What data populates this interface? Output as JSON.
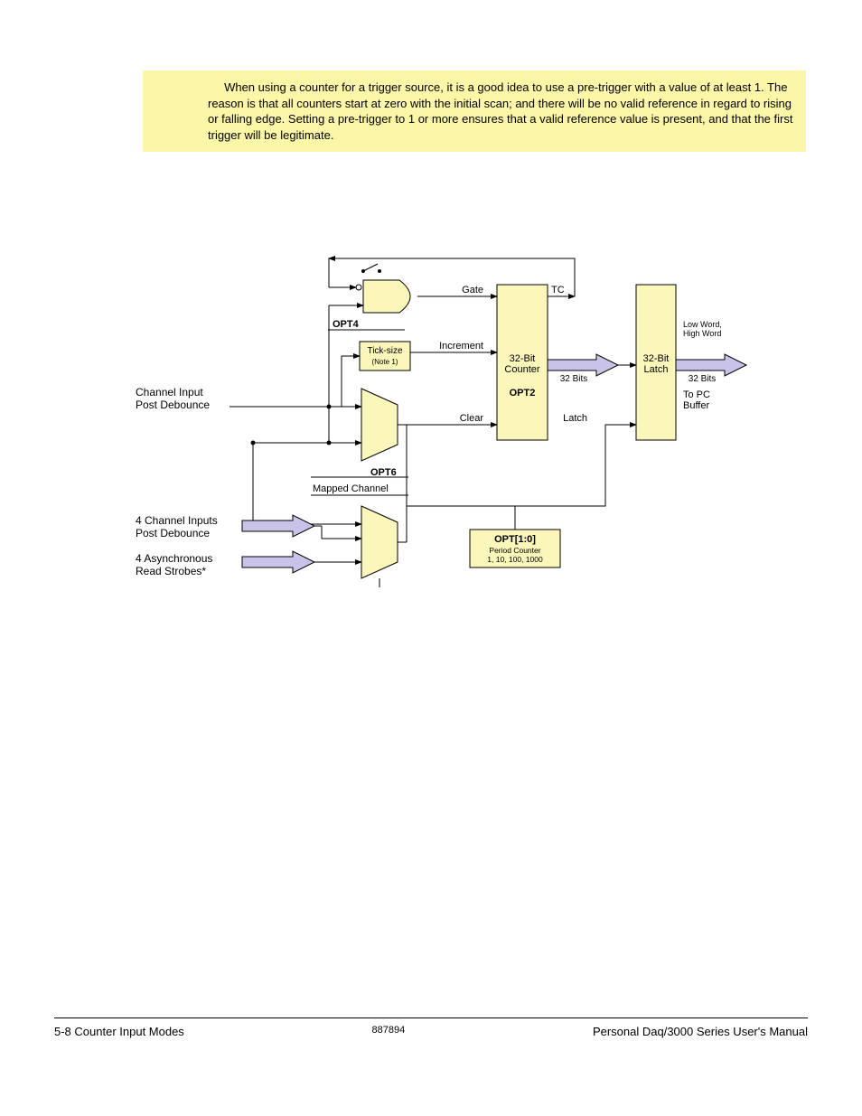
{
  "tip": {
    "text": "When using a counter for a trigger source, it is a good idea to use a pre-trigger with a value of at least 1. The reason is that all counters start at zero with the initial scan; and there will be no valid reference in regard to rising or falling edge. Setting a pre-trigger to 1 or more ensures that a valid reference value is present, and that the first trigger will be legitimate."
  },
  "diagram": {
    "opt4": "OPT4",
    "opt6": "OPT6",
    "opt2": "OPT2",
    "opt10_title": "OPT[1:0]",
    "opt10_sub1": "Period Counter",
    "opt10_sub2": "1, 10, 100, 1000",
    "gate": "Gate",
    "tc": "TC",
    "tick_size": "Tick-size",
    "tick_note": "(Note 1)",
    "increment": "Increment",
    "clear": "Clear",
    "latch": "Latch",
    "counter_32": "32-Bit\nCounter",
    "latch_32": "32-Bit\nLatch",
    "bits_32_a": "32 Bits",
    "bits_32_b": "32 Bits",
    "low_high": "Low Word,\nHigh Word",
    "to_pc": "To PC\nBuffer",
    "channel_input": "Channel Input\nPost Debounce",
    "mapped_channel": "Mapped Channel",
    "four_inputs": "4 Channel Inputs\nPost Debounce",
    "four_strobes": "4 Asynchronous\nRead Strobes*"
  },
  "footer": {
    "left": "5-8   Counter Input Modes",
    "center": "887894",
    "right": "Personal Daq/3000 Series User's Manual"
  }
}
